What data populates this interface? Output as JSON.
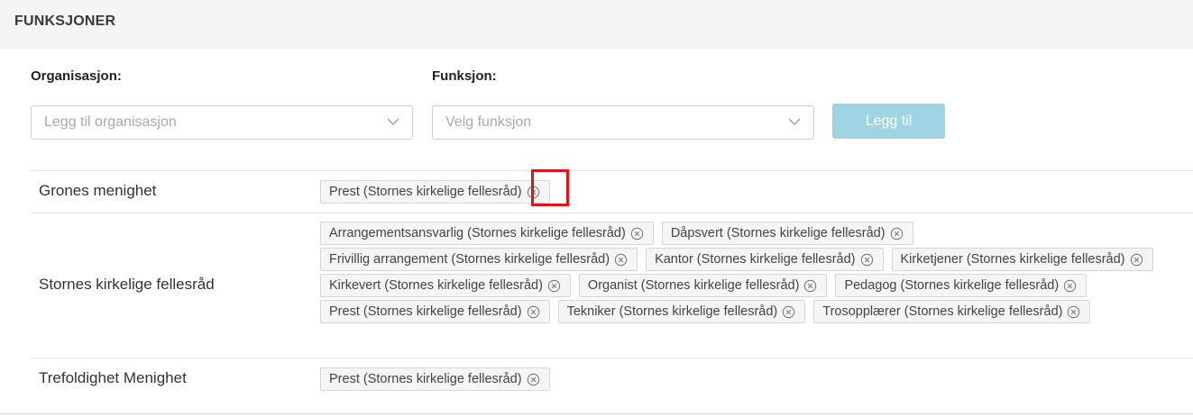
{
  "header": {
    "title": "FUNKSJONER"
  },
  "form": {
    "org_label": "Organisasjon:",
    "org_placeholder": "Legg til organisasjon",
    "func_label": "Funksjon:",
    "func_placeholder": "Velg funksjon",
    "add_button": "Legg til"
  },
  "rows": [
    {
      "name": "Grones menighet",
      "tags": [
        "Prest (Stornes kirkelige fellesråd)"
      ]
    },
    {
      "name": "Stornes kirkelige fellesråd",
      "tags": [
        "Arrangementsansvarlig (Stornes kirkelige fellesråd)",
        "Dåpsvert (Stornes kirkelige fellesråd)",
        "Frivillig arrangement (Stornes kirkelige fellesråd)",
        "Kantor (Stornes kirkelige fellesråd)",
        "Kirketjener (Stornes kirkelige fellesråd)",
        "Kirkevert (Stornes kirkelige fellesråd)",
        "Organist (Stornes kirkelige fellesråd)",
        "Pedagog (Stornes kirkelige fellesråd)",
        "Prest (Stornes kirkelige fellesråd)",
        "Tekniker (Stornes kirkelige fellesråd)",
        "Trosopplærer (Stornes kirkelige fellesråd)"
      ]
    },
    {
      "name": "Trefoldighet Menighet",
      "tags": [
        "Prest (Stornes kirkelige fellesråd)"
      ]
    }
  ],
  "icons": {
    "remove": "close-circle-icon",
    "dropdown": "chevron-down-icon"
  },
  "colors": {
    "button": "#9fd4e3",
    "highlight": "#e0131a"
  }
}
